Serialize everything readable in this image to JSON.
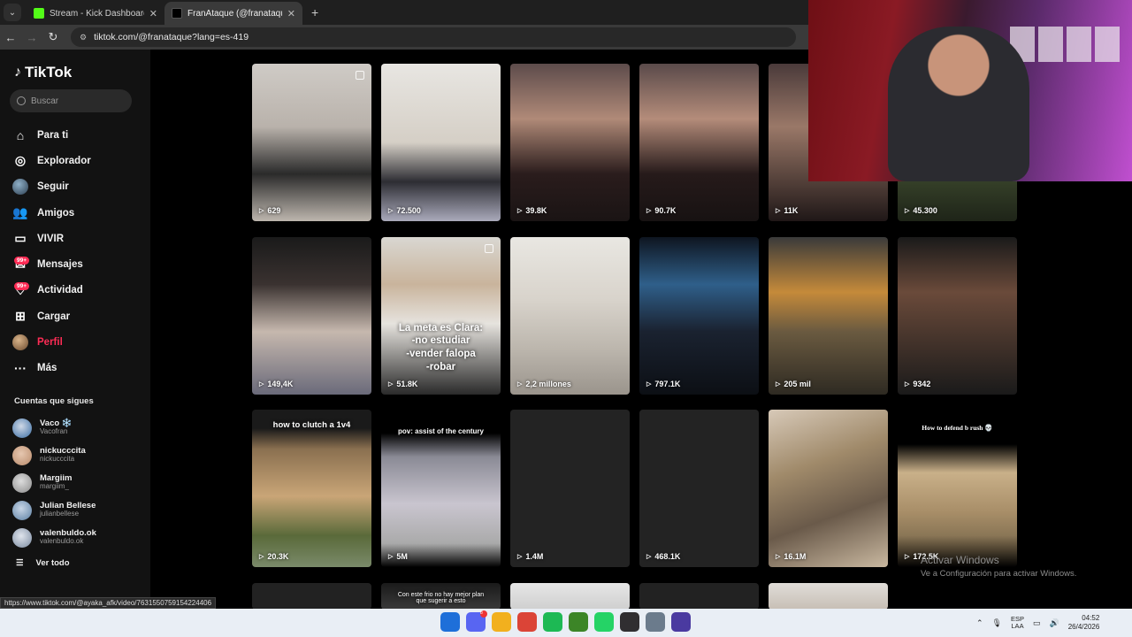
{
  "browser": {
    "tabs": [
      {
        "label": "Stream - Kick Dashboard",
        "active": false,
        "icon": "kick-icon",
        "color": "#53fc18"
      },
      {
        "label": "FranAtaque (@franataque) | Tik",
        "active": true,
        "icon": "tiktok-icon",
        "color": "#000000"
      }
    ],
    "url": "tiktok.com/@franataque?lang=es-419"
  },
  "sidebar": {
    "logo": "TikTok",
    "search_placeholder": "Buscar",
    "nav": [
      {
        "label": "Para ti",
        "icon": "home-icon"
      },
      {
        "label": "Explorador",
        "icon": "compass-icon"
      },
      {
        "label": "Seguir",
        "icon": "following-avatar-icon"
      },
      {
        "label": "Amigos",
        "icon": "friends-icon"
      },
      {
        "label": "VIVIR",
        "icon": "live-icon"
      },
      {
        "label": "Mensajes",
        "icon": "messages-icon",
        "badge": "99+"
      },
      {
        "label": "Actividad",
        "icon": "activity-icon",
        "badge": "99+"
      },
      {
        "label": "Cargar",
        "icon": "upload-icon"
      },
      {
        "label": "Perfil",
        "icon": "profile-avatar-icon",
        "active": true
      },
      {
        "label": "Más",
        "icon": "more-icon"
      }
    ],
    "following_title": "Cuentas que sigues",
    "following": [
      {
        "name": "Vaco ❄️",
        "handle": "Vacofran",
        "color": "#3a6ea5"
      },
      {
        "name": "nickucccita",
        "handle": "nickucccita",
        "color": "#b88a6a"
      },
      {
        "name": "Margiim",
        "handle": "margiim_",
        "color": "#9a9a9a"
      },
      {
        "name": "Julian Bellese",
        "handle": "julianbellese",
        "color": "#5b7fa3"
      },
      {
        "name": "valenbuldo.ok",
        "handle": "valenbuldo.ok",
        "color": "#7a8aa0"
      }
    ],
    "see_all": "Ver todo"
  },
  "videos": [
    {
      "views": "629",
      "bg": "linear-gradient(180deg,#cfcbc6 0%,#b9b2ab 40%,#2a2a2a 70%,#bdb6ae 100%)",
      "pinned": true
    },
    {
      "views": "72.500",
      "bg": "linear-gradient(180deg,#e8e6e2 0%,#d5cfc6 50%,#2d2d33 75%,#aab 100%)"
    },
    {
      "views": "39.8K",
      "bg": "linear-gradient(180deg,#5d4b4b 0%,#b08a78 35%,#2a1c1c 70%,#1a1414 100%)"
    },
    {
      "views": "90.7K",
      "bg": "linear-gradient(180deg,#5a4a4a 0%,#b48c7a 35%,#261a1a 70%,#171212 100%)"
    },
    {
      "views": "11K",
      "bg": "linear-gradient(180deg,#4a3a3a 0%,#9a7868 40%,#1f1717 100%)"
    },
    {
      "views": "45.300",
      "bg": "linear-gradient(180deg,#2a3020 0%,#4b5a38 50%,#1e2418 100%)"
    },
    {
      "views": "149,4K",
      "bg": "linear-gradient(180deg,#1a1a1a 0%,#3a3230 30%,#c6b8ae 60%,#6a6a7a 100%)"
    },
    {
      "views": "51.8K",
      "bg": "linear-gradient(180deg,#d9d7d2 0%,#c9b49c 30%,#e6e3de 55%,#2a2a2a 100%)",
      "pinned": true,
      "text": "La meta es Clara:\n-no estudiar\n-vender falopa\n-robar"
    },
    {
      "views": "2,2 millones",
      "bg": "linear-gradient(180deg,#e9e7e2 0%,#d8d3cb 40%,#bdb7ae 70%,#9a948c 100%)"
    },
    {
      "views": "797.1K",
      "bg": "linear-gradient(180deg,#0e1520 0%,#2f5f8a 30%,#1a2230 60%,#0c0f14 100%)"
    },
    {
      "views": "205 mil",
      "bg": "linear-gradient(180deg,#3a3a3a 0%,#c58a3a 35%,#6a5a40 60%,#2e2a22 100%)"
    },
    {
      "views": "9342",
      "bg": "linear-gradient(180deg,#1a1a1a 0%,#6a4a3a 35%,#1a1a1a 100%)"
    },
    {
      "views": "20.3K",
      "bg": "linear-gradient(180deg,#1a1a1a 0%,#1a1a1a 12%,#8a7050 25%,#c9a577 55%,#5a6a3a 80%,#7a8a6a 100%)",
      "text": "how to clutch a 1v4"
    },
    {
      "views": "5M",
      "bg": "linear-gradient(180deg,#000 0%,#000 15%,#8a8a95 30%,#c9c5cf 60%,#aaa 85%,#000 100%)",
      "text": "pov: assist of the century"
    },
    {
      "views": "1.4M",
      "bg": "#232323"
    },
    {
      "views": "468.1K",
      "bg": "#232323"
    },
    {
      "views": "16.1M",
      "bg": "linear-gradient(160deg,#d7c9b8 0%,#a08a6a 35%,#6a5a4a 65%,#c9b8a0 100%)"
    },
    {
      "views": "172.5K",
      "bg": "linear-gradient(180deg,#000 0%,#000 22%,#c9b089 40%,#a88e68 65%,#8a7656 80%,#000 100%)",
      "text": "How to defend b rush 💀"
    },
    {
      "views": "",
      "bg": "#222222"
    },
    {
      "views": "",
      "bg": "linear-gradient(180deg,#1a1a1a 0%,#3a3a3a 100%)",
      "text": "Con este frio no hay mejor plan que sugerir a esto"
    },
    {
      "views": "",
      "bg": "linear-gradient(180deg,#e6e6e6 0%,#cfcfcf 100%)"
    },
    {
      "views": "",
      "bg": "#222222"
    },
    {
      "views": "",
      "bg": "linear-gradient(180deg,#e0ddd8 0%,#c7bfb5 100%)"
    }
  ],
  "status_url": "https://www.tiktok.com/@ayaka_afk/video/7631550759154224406",
  "windows_watermark": {
    "line1": "Activar Windows",
    "line2": "Ve a Configuración para activar Windows."
  },
  "taskbar": {
    "apps": [
      {
        "icon": "windows-start-icon",
        "color": "#1e6fd9"
      },
      {
        "icon": "discord-icon",
        "color": "#5865f2",
        "badge": "8"
      },
      {
        "icon": "file-explorer-icon",
        "color": "#f2b01e"
      },
      {
        "icon": "chrome-icon",
        "color": "#db4437"
      },
      {
        "icon": "spotify-icon",
        "color": "#1db954"
      },
      {
        "icon": "minecraft-icon",
        "color": "#3c8527"
      },
      {
        "icon": "whatsapp-icon",
        "color": "#25d366"
      },
      {
        "icon": "obs-icon",
        "color": "#302e31"
      },
      {
        "icon": "settings-icon",
        "color": "#6b7b8c"
      },
      {
        "icon": "app-icon",
        "color": "#4a3aa0"
      }
    ],
    "lang_top": "ESP",
    "lang_bottom": "LAA",
    "time": "04:52",
    "date": "26/4/2026"
  }
}
